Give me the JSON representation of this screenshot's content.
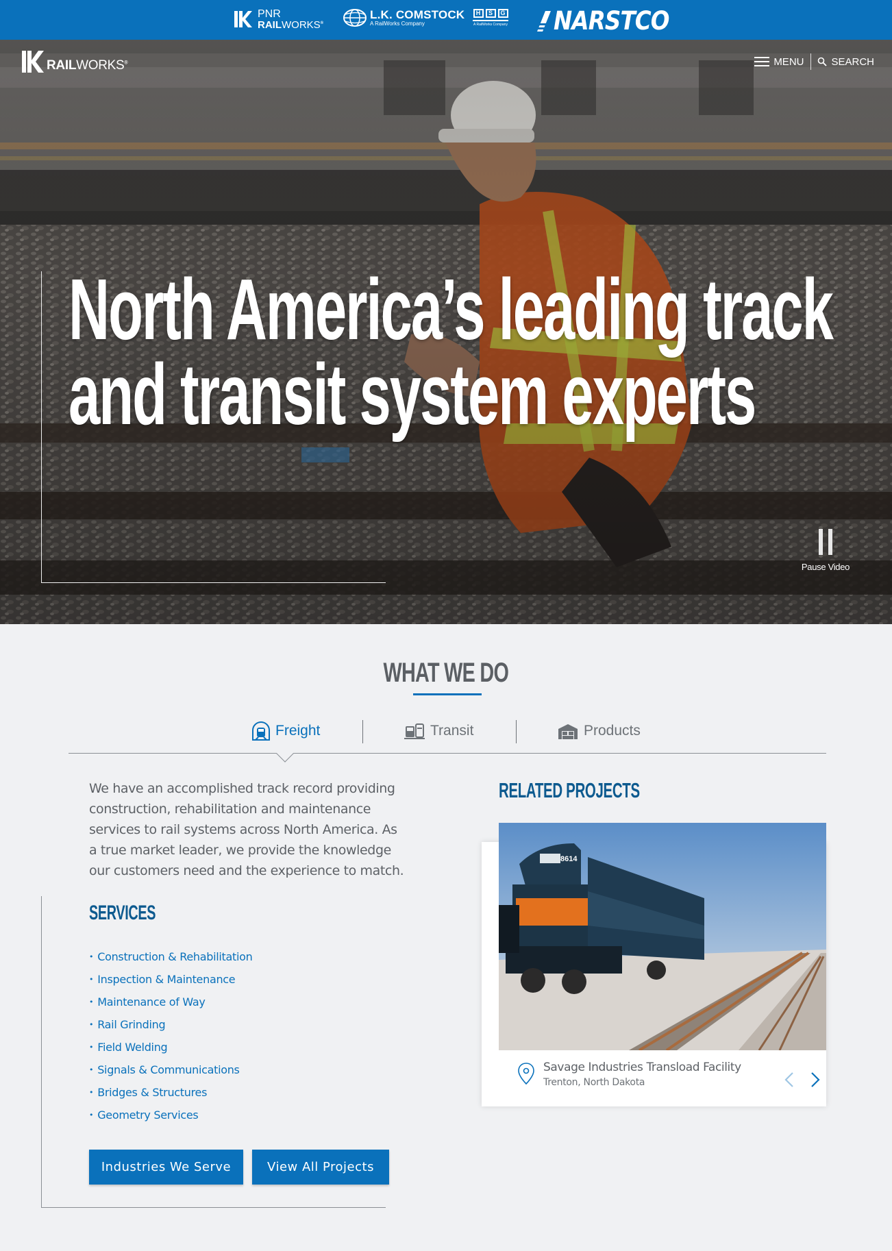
{
  "brand_bar": {
    "pnr": {
      "line1": "PNR",
      "line2_bold": "RAIL",
      "line2_rest": "WORKS"
    },
    "lkc": {
      "name": "L.K. COMSTOCK",
      "tagline": "A RailWorks Company"
    },
    "hsg": {
      "letters": [
        "H",
        "S",
        "G"
      ],
      "tagline": "A RailWorks Company"
    },
    "narstco": {
      "name": "NARSTCO"
    }
  },
  "header": {
    "logo": {
      "bold": "RAIL",
      "rest": "WORKS"
    },
    "menu_label": "MENU",
    "search_label": "SEARCH"
  },
  "hero": {
    "title_line1": "North America’s leading track",
    "title_line2": "and transit system experts",
    "pause_label": "Pause Video"
  },
  "what_we_do": {
    "title": "WHAT WE DO",
    "tabs": [
      {
        "label": "Freight",
        "icon": "tunnel-train-icon",
        "active": true
      },
      {
        "label": "Transit",
        "icon": "transit-icon",
        "active": false
      },
      {
        "label": "Products",
        "icon": "warehouse-icon",
        "active": false
      }
    ],
    "intro": "We have an accomplished track record providing construction, rehabilitation and maintenance services to rail systems across North America. As a true market leader, we provide the knowledge our customers need and the experience to match.",
    "services_title": "SERVICES",
    "services": [
      "Construction & Rehabilitation",
      "Inspection & Maintenance",
      "Maintenance of Way",
      "Rail Grinding",
      "Field Welding",
      "Signals & Communications",
      "Bridges & Structures",
      "Geometry Services"
    ],
    "buttons": {
      "industries": "Industries We Serve",
      "projects": "View All Projects"
    }
  },
  "related_projects": {
    "title": "RELATED PROJECTS",
    "project": {
      "name": "Savage Industries Transload Facility",
      "location": "Trenton, North Dakota",
      "locomotive_number": "8614"
    },
    "prev_icon": "chevron-left-icon",
    "next_icon": "chevron-right-icon"
  },
  "colors": {
    "primary": "#0a71bb",
    "heading_blue": "#0d5a8f",
    "background": "#f0f1f3"
  }
}
